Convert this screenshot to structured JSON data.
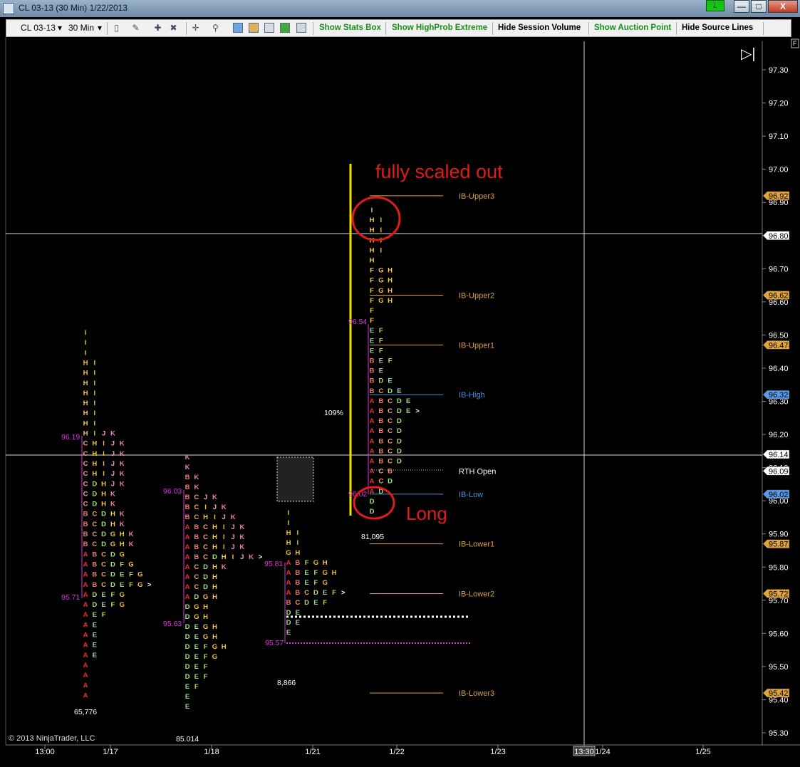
{
  "window": {
    "title": "CL 03-13 (30 Min)  1/22/2013",
    "link_label": "L",
    "minimize_glyph": "—",
    "maximize_glyph": "□",
    "close_glyph": "X"
  },
  "toolbar": {
    "instrument": "CL 03-13",
    "period": "30 Min",
    "dropdown_glyph": "▾",
    "icons": [
      "bars-type-icon",
      "pencil-draw-icon",
      "add-indicator-icon",
      "remove-indicator-icon",
      "crosshair-icon",
      "zoom-icon",
      "strategies-icon",
      "chart-trader-icon",
      "data-box-icon",
      "money-icon",
      "properties-icon"
    ],
    "buttons": [
      {
        "label": "Show Stats Box",
        "color": "#1a8c1a"
      },
      {
        "label": "Show HighProb Extreme",
        "color": "#1a8c1a"
      },
      {
        "label": "Hide Session Volume",
        "color": "#000000"
      },
      {
        "label": "Show Auction Point",
        "color": "#1a8c1a"
      },
      {
        "label": "Hide Source Lines",
        "color": "#000000"
      }
    ]
  },
  "chart": {
    "copyright": "© 2013 NinjaTrader, LLC",
    "panel_tag": "F",
    "scroll_glyph": "▷|",
    "colors": {
      "background": "#000000",
      "axis_text": "#ffffff",
      "ib_orange": "#d8a044",
      "ib_blue": "#4a8fe0",
      "poc_magenta": "#e030e0",
      "annotation_red": "#e21b1b",
      "yellow": "#f0e000",
      "current_price_badge": "#ffffff",
      "label_badge_orange": "#e0a43a",
      "label_badge_blue": "#5a9ae8"
    },
    "y_axis": {
      "min": 95.3,
      "max": 97.3,
      "ticks": [
        "97.30",
        "97.20",
        "97.10",
        "97.00",
        "96.90",
        "96.80",
        "96.70",
        "96.60",
        "96.50",
        "96.40",
        "96.30",
        "96.20",
        "96.10",
        "96.00",
        "95.90",
        "95.80",
        "95.70",
        "95.60",
        "95.50",
        "95.40",
        "95.30"
      ]
    },
    "x_axis": {
      "labels": [
        "13:00",
        "1/17",
        "1/18",
        "1/21",
        "1/22",
        "1/23",
        "13:30",
        "1/24",
        "1/25"
      ]
    },
    "price_markers": [
      {
        "value": "96.92",
        "kind": "orange"
      },
      {
        "value": "96.80",
        "kind": "white"
      },
      {
        "value": "96.62",
        "kind": "orange"
      },
      {
        "value": "96.47",
        "kind": "orange"
      },
      {
        "value": "96.32",
        "kind": "blue"
      },
      {
        "value": "96.14",
        "kind": "white"
      },
      {
        "value": "96.09",
        "kind": "white"
      },
      {
        "value": "96.02",
        "kind": "blue"
      },
      {
        "value": "95.87",
        "kind": "orange"
      },
      {
        "value": "95.72",
        "kind": "orange"
      },
      {
        "value": "95.42",
        "kind": "orange"
      }
    ],
    "level_lines": [
      {
        "name": "IB-Upper3",
        "price": 96.92,
        "kind": "orange"
      },
      {
        "name": "IB-Upper2",
        "price": 96.62,
        "kind": "orange"
      },
      {
        "name": "IB-Upper1",
        "price": 96.47,
        "kind": "orange"
      },
      {
        "name": "IB-High",
        "price": 96.32,
        "kind": "blue"
      },
      {
        "name": "RTH Open",
        "price": 96.09,
        "kind": "white"
      },
      {
        "name": "IB-Low",
        "price": 96.02,
        "kind": "blue"
      },
      {
        "name": "IB-Lower1",
        "price": 95.87,
        "kind": "orange"
      },
      {
        "name": "IB-Lower2",
        "price": 95.72,
        "kind": "orange"
      },
      {
        "name": "IB-Lower3",
        "price": 95.42,
        "kind": "orange"
      }
    ],
    "session_labels": [
      {
        "text": "96.19",
        "kind": "magenta"
      },
      {
        "text": "95.71",
        "kind": "magenta"
      },
      {
        "text": "65,776",
        "kind": "white"
      },
      {
        "text": "96.03",
        "kind": "magenta"
      },
      {
        "text": "95.63",
        "kind": "magenta"
      },
      {
        "text": "85.014",
        "kind": "white"
      },
      {
        "text": "95.81",
        "kind": "magenta"
      },
      {
        "text": "95.57",
        "kind": "magenta"
      },
      {
        "text": "8,866",
        "kind": "white"
      },
      {
        "text": "96.54",
        "kind": "magenta"
      },
      {
        "text": "96.02",
        "kind": "magenta"
      },
      {
        "text": "81,095",
        "kind": "white"
      },
      {
        "text": "109%",
        "kind": "white"
      }
    ],
    "annotations": {
      "scaled_out": "fully scaled out",
      "long": "Long"
    },
    "profiles": [
      {
        "name": "profile-1-16",
        "rows": [
          "I",
          "I",
          "I",
          "HI",
          "HI",
          "HI",
          "HI",
          "HI",
          "HI",
          "HI",
          "HIJK",
          "CHIJK",
          "CHIJK",
          "CHIJK",
          "CHIJK",
          "CDHJK",
          "CDHK",
          "CDHK",
          "BCDHK",
          "BCDHK",
          "BCDGHK",
          "BCDGHK",
          "ABCDG",
          "ABCDFG",
          "ABCDEFG",
          "ABCDEFG>",
          "ADEFG",
          "ADEFG",
          "AEF",
          "AE",
          "AE",
          "AE",
          "AE",
          "A",
          "A",
          "A",
          "A"
        ]
      },
      {
        "name": "profile-1-17",
        "rows": [
          "K",
          "K",
          "BK",
          "BK",
          "BCJK",
          "BCIJK",
          "BCHIJK",
          "ABCHIJK",
          "ABCHIJK",
          "ABCHIJK",
          "ABCDHIJK>",
          "ACDHK",
          "ACDH",
          "ACDH",
          "ADGH",
          "DGH",
          "DGH",
          "DEGH",
          "DEGH",
          "DEFGH",
          "DEFG",
          "DEF",
          "DEF",
          "EF",
          "E",
          "E"
        ]
      },
      {
        "name": "profile-1-18",
        "rows": [
          "I",
          "I",
          "HI",
          "HI",
          "GH",
          "ABFGH",
          "ABEFGH",
          "ABEFG",
          "ABCDEF>",
          "BCDEF",
          "DE",
          "DE",
          "E"
        ]
      },
      {
        "name": "profile-1-21",
        "rows": [
          "I",
          "HI",
          "HI",
          "HI",
          "HI",
          "H",
          "FGH",
          "FGH",
          "FGH",
          "FGH",
          "F",
          "F",
          "EF",
          "EF",
          "EF",
          "BEF",
          "BE",
          "BDE",
          "BCDE",
          "ABCDE",
          "ABCDE>",
          "ABCD",
          "ABCD",
          "ABCD",
          "ABCD",
          "ABCD",
          "ACB",
          "ACD",
          "AD",
          "D",
          "D"
        ]
      },
      {
        "name": "overnight-box",
        "rows": [
          "I",
          "I",
          "I",
          "I"
        ]
      }
    ]
  }
}
